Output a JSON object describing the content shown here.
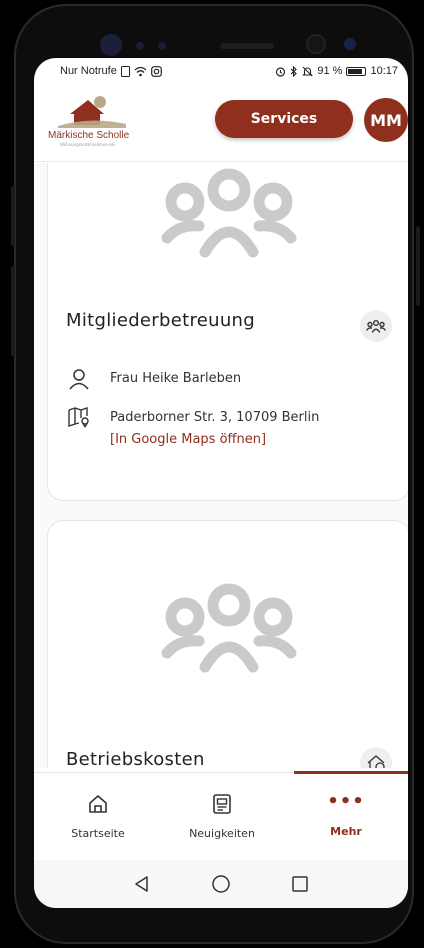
{
  "status_bar": {
    "carrier": "Nur Notrufe",
    "battery": "91 %",
    "time": "10:17"
  },
  "header": {
    "logo_name": "Märkische Scholle",
    "logo_sub": "Wohnungsunternehmen eG",
    "services_label": "Services",
    "avatar_initials": "MM"
  },
  "cards": [
    {
      "title": "Mitgliederbetreuung",
      "person": "Frau Heike Barleben",
      "address": "Paderborner Str. 3, 10709 Berlin",
      "maps_link": "[In Google Maps öffnen]"
    },
    {
      "title": "Betriebskosten"
    }
  ],
  "bottom_nav": {
    "items": [
      {
        "label": "Startseite",
        "icon": "home-icon"
      },
      {
        "label": "Neuigkeiten",
        "icon": "newspaper-icon"
      },
      {
        "label": "Mehr",
        "icon": "more-dots-icon",
        "active": true
      }
    ]
  },
  "colors": {
    "brand": "#8f2f1e",
    "placeholder_icon": "#c9cacc"
  }
}
